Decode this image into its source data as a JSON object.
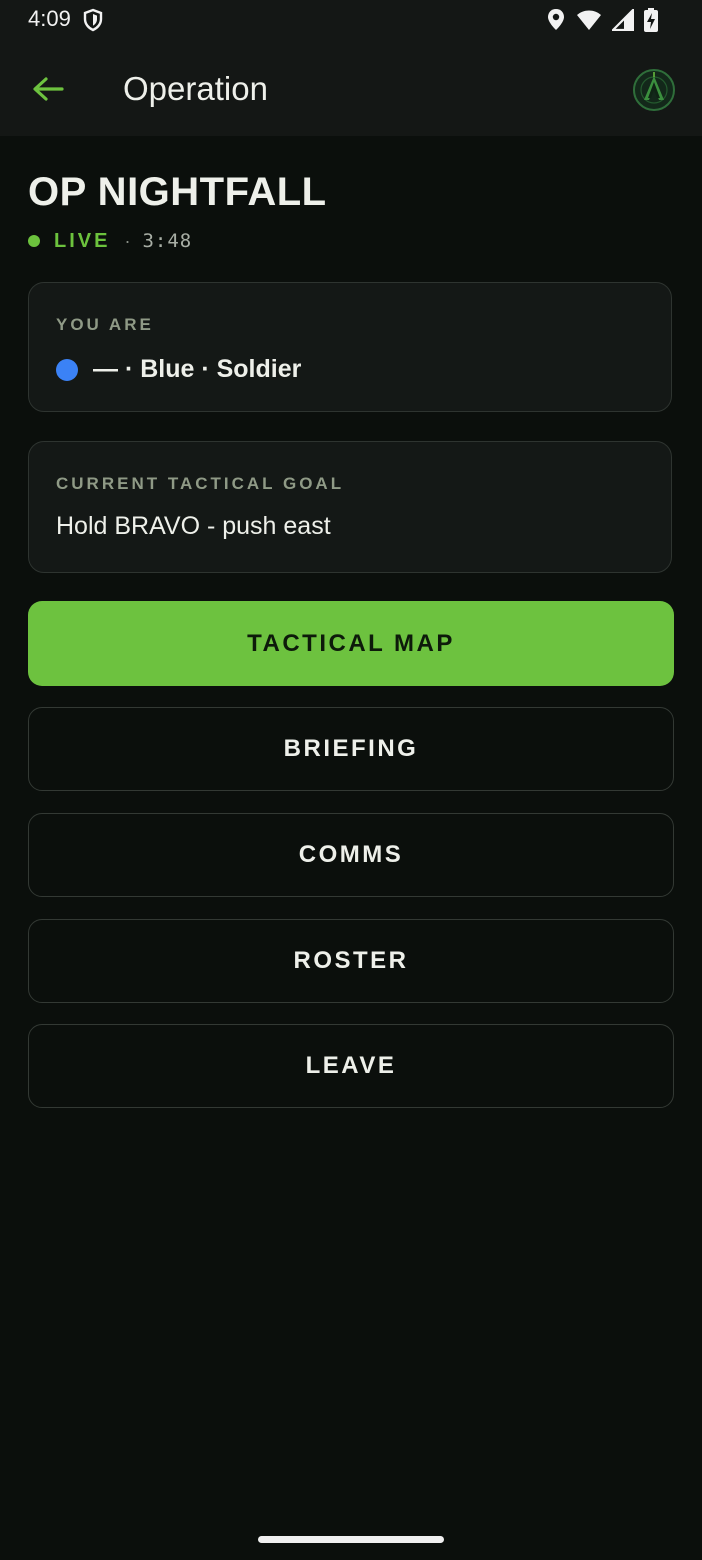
{
  "status_bar": {
    "time": "4:09"
  },
  "app_bar": {
    "title": "Operation"
  },
  "operation": {
    "name": "OP NIGHTFALL",
    "status": "LIVE",
    "separator": "·",
    "timer": "3:48"
  },
  "you_card": {
    "label": "YOU ARE",
    "identity": "— · Blue · Soldier",
    "team_color": "#3b82f6"
  },
  "goal_card": {
    "label": "CURRENT TACTICAL GOAL",
    "text": "Hold BRAVO - push east"
  },
  "buttons": {
    "tactical_map": "TACTICAL MAP",
    "briefing": "BRIEFING",
    "comms": "COMMS",
    "roster": "ROSTER",
    "leave": "LEAVE"
  },
  "colors": {
    "accent": "#6dc23f",
    "background": "#0b0f0c",
    "surface": "#141816"
  },
  "icons": {
    "status_left": "shield-icon",
    "status_right": [
      "location-icon",
      "wifi-icon",
      "cellular-signal-icon",
      "battery-charging-icon"
    ],
    "back": "arrow-left-icon",
    "logo": "app-logo-icon"
  }
}
